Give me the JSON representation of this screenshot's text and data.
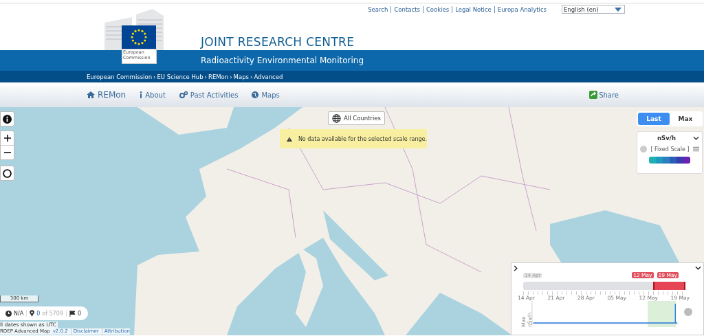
{
  "top_links": [
    "Search",
    "Contacts",
    "Cookies",
    "Legal Notice",
    "Europa Analytics"
  ],
  "language_select": {
    "value": "English (en)"
  },
  "logo": {
    "caption": "European Commission"
  },
  "site_title": "JOINT RESEARCH CENTRE",
  "site_subtitle": "Radioactivity Environmental Monitoring",
  "breadcrumb": [
    "European Commission",
    "EU Science Hub",
    "REMon",
    "Maps",
    "Advanced"
  ],
  "breadcrumb_separator": "›",
  "nav": [
    {
      "label": "REMon",
      "kind": "home"
    },
    {
      "label": "About",
      "kind": "info"
    },
    {
      "label": "Past Activities",
      "kind": "gears"
    },
    {
      "label": "Maps",
      "kind": "globe"
    }
  ],
  "share": "Share",
  "map": {
    "country_filter": "All Countries",
    "notice": "No data available for the selected scale range.",
    "scale": "300 km"
  },
  "value_tabs": [
    {
      "label": "Last",
      "selected": true
    },
    {
      "label": "Max",
      "selected": false
    }
  ],
  "legend": {
    "unit": "nSv/h",
    "mode": "[ Fixed Scale ]",
    "swatches": [
      {
        "color": "#1fb0b5"
      },
      {
        "color": "#1f9aba"
      },
      {
        "color": "#2a7fbf"
      },
      {
        "color": "#2b5db8"
      },
      {
        "color": "#3a3ab0"
      },
      {
        "color": "#6a22b0"
      }
    ]
  },
  "stats": {
    "time": "N/A",
    "stations": "0",
    "stations_total": "of 5709",
    "flags": "0"
  },
  "footer": {
    "note": "ll dates shown as UTC",
    "app": "RDEP Advanced Map",
    "version": "v2.0.2",
    "links": [
      "Disclaimer",
      "Attribution"
    ]
  },
  "timeline": {
    "start_label": "14 Apr",
    "range_start": "12 May",
    "range_end": "19 May",
    "level": 0.2,
    "ticks": [
      "14 Apr",
      "21 Apr",
      "28 Apr",
      "05 May",
      "12 May",
      "19 May"
    ],
    "ylabel": "Max nSv/h"
  }
}
